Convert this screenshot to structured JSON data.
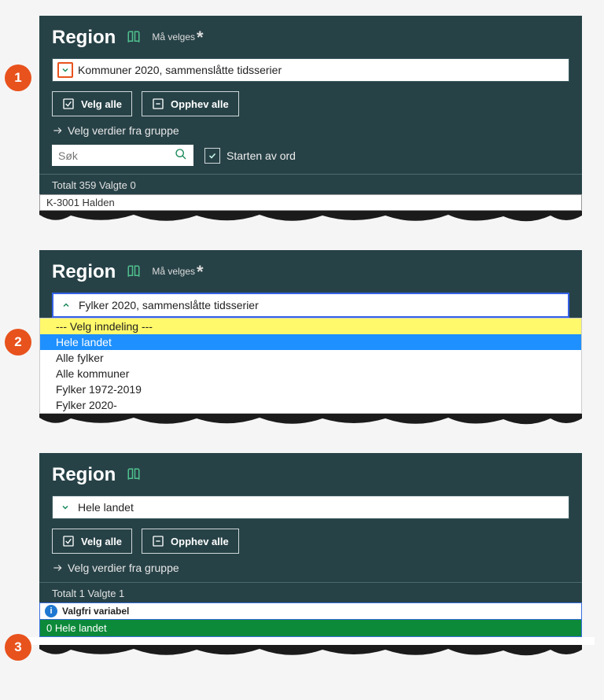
{
  "panel1": {
    "title": "Region",
    "required": "Må velges",
    "selectValue": "Kommuner 2020, sammenslåtte tidsserier",
    "selectAll": "Velg alle",
    "deselectAll": "Opphev alle",
    "groupLink": "Velg verdier fra gruppe",
    "searchPlaceholder": "Søk",
    "wordStart": "Starten av ord",
    "stats": "Totalt 359 Valgte 0",
    "firstItem": "K-3001 Halden"
  },
  "panel2": {
    "title": "Region",
    "required": "Må velges",
    "selectValue": "Fylker 2020, sammenslåtte tidsserier",
    "options": [
      "--- Velg inndeling ---",
      "Hele landet",
      "Alle fylker",
      "Alle kommuner",
      "Fylker 1972-2019",
      "Fylker 2020-"
    ]
  },
  "panel3": {
    "title": "Region",
    "selectValue": "Hele landet",
    "selectAll": "Velg alle",
    "deselectAll": "Opphev alle",
    "groupLink": "Velg verdier fra gruppe",
    "stats": "Totalt 1 Valgte 1",
    "infoLabel": "Valgfri variabel",
    "selectedRow": "0 Hele landet"
  },
  "badges": {
    "b1": "1",
    "b2": "2",
    "b3": "3"
  }
}
